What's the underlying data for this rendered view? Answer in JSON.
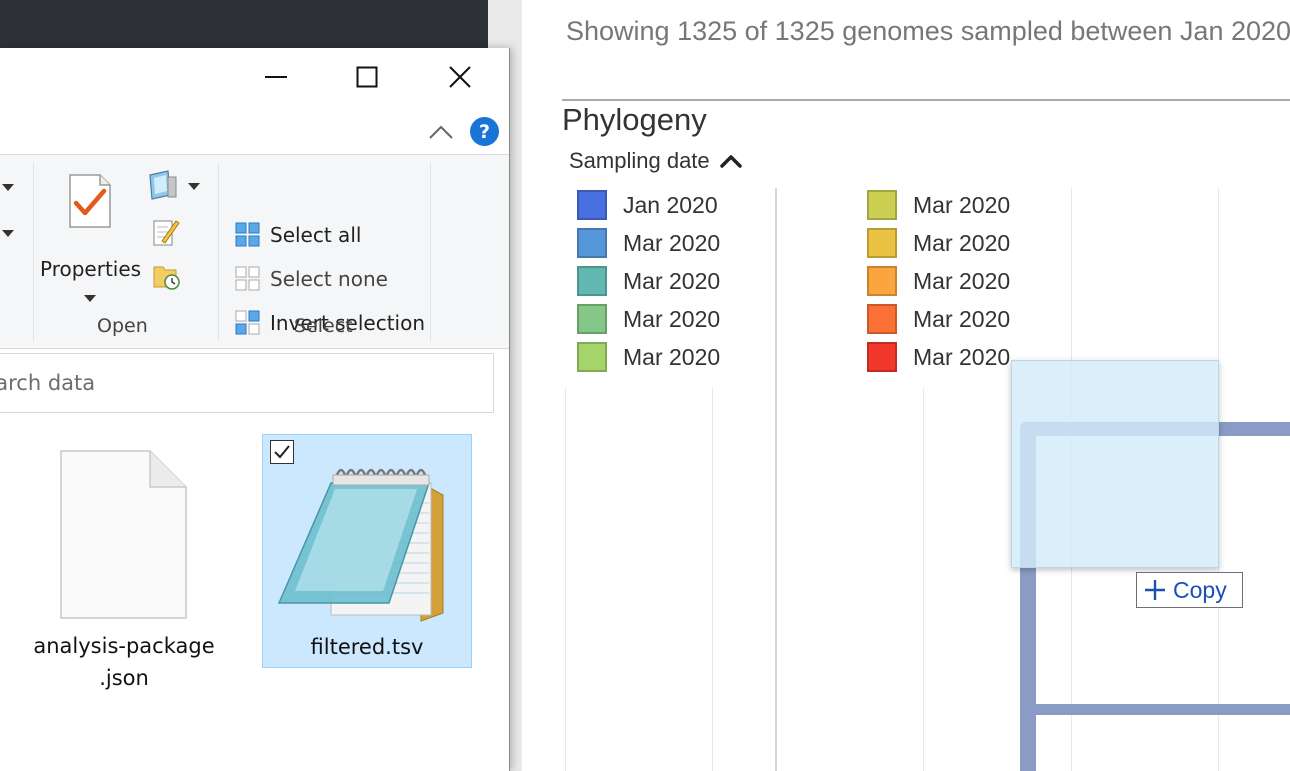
{
  "web": {
    "subtitle": "Showing 1325 of 1325 genomes sampled between Jan 2020",
    "panel_title": "Phylogeny",
    "legend_toggle_label": "Sampling date",
    "legend": [
      {
        "label": "Jan 2020",
        "color": "#4a6fe3"
      },
      {
        "label": "Mar 2020",
        "color": "#5597d9"
      },
      {
        "label": "Mar 2020",
        "color": "#62b8b1"
      },
      {
        "label": "Mar 2020",
        "color": "#84c786"
      },
      {
        "label": "Mar 2020",
        "color": "#a5d46a"
      },
      {
        "label": "Mar 2020",
        "color": "#cbd053"
      },
      {
        "label": "Mar 2020",
        "color": "#eac244"
      },
      {
        "label": "Mar 2020",
        "color": "#fca43d"
      },
      {
        "label": "Mar 2020",
        "color": "#fb7034"
      },
      {
        "label": "Mar 2020",
        "color": "#f1372b"
      }
    ],
    "drag_tooltip": "Copy"
  },
  "explorer": {
    "ribbon": {
      "open_group": {
        "label": "Open",
        "properties_label": "Properties",
        "icons": [
          "open-with-icon",
          "edit-icon",
          "history-icon"
        ]
      },
      "select_group": {
        "label": "Select",
        "select_all": "Select all",
        "select_none": "Select none",
        "invert_selection": "Invert selection"
      }
    },
    "search_placeholder": "Search data",
    "files": [
      {
        "name_line1": "analysis-package",
        "name_line2": ".json",
        "icon": "blank-file-icon",
        "selected": false
      },
      {
        "name_line1": "filtered.tsv",
        "icon": "notepad-icon",
        "selected": true
      }
    ]
  }
}
